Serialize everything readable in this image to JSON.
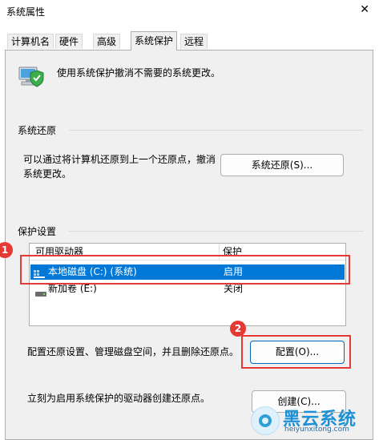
{
  "window": {
    "title": "系统属性",
    "close_glyph": "✕"
  },
  "tabs": [
    {
      "label": "计算机名"
    },
    {
      "label": "硬件"
    },
    {
      "label": "高级"
    },
    {
      "label": "系统保护",
      "active": true
    },
    {
      "label": "远程"
    }
  ],
  "intro": {
    "text": "使用系统保护撤消不需要的系统更改。",
    "icon": "computer-shield-icon"
  },
  "restore": {
    "heading": "系统还原",
    "description_line1": "可以通过将计算机还原到上一个还原点，撤消",
    "description_line2": "系统更改。",
    "button": "系统还原(S)..."
  },
  "protection": {
    "heading": "保护设置",
    "columns": [
      "可用驱动器",
      "保护"
    ],
    "rows": [
      {
        "drive": "本地磁盘 (C:) (系统)",
        "status": "启用",
        "selected": true,
        "icon": "system-drive-icon"
      },
      {
        "drive": "新加卷 (E:)",
        "status": "关闭",
        "selected": false,
        "icon": "drive-icon"
      }
    ]
  },
  "configure": {
    "text": "配置还原设置、管理磁盘空间，并且删除还原点。",
    "button": "配置(O)..."
  },
  "create": {
    "text": "立刻为启用系统保护的驱动器创建还原点。",
    "button": "创建(C)..."
  },
  "annotations": {
    "badge1": "1",
    "badge2": "2",
    "color": "#e53935"
  },
  "watermark": {
    "title": "黑云系统",
    "url": "heiyunxitong.com"
  }
}
